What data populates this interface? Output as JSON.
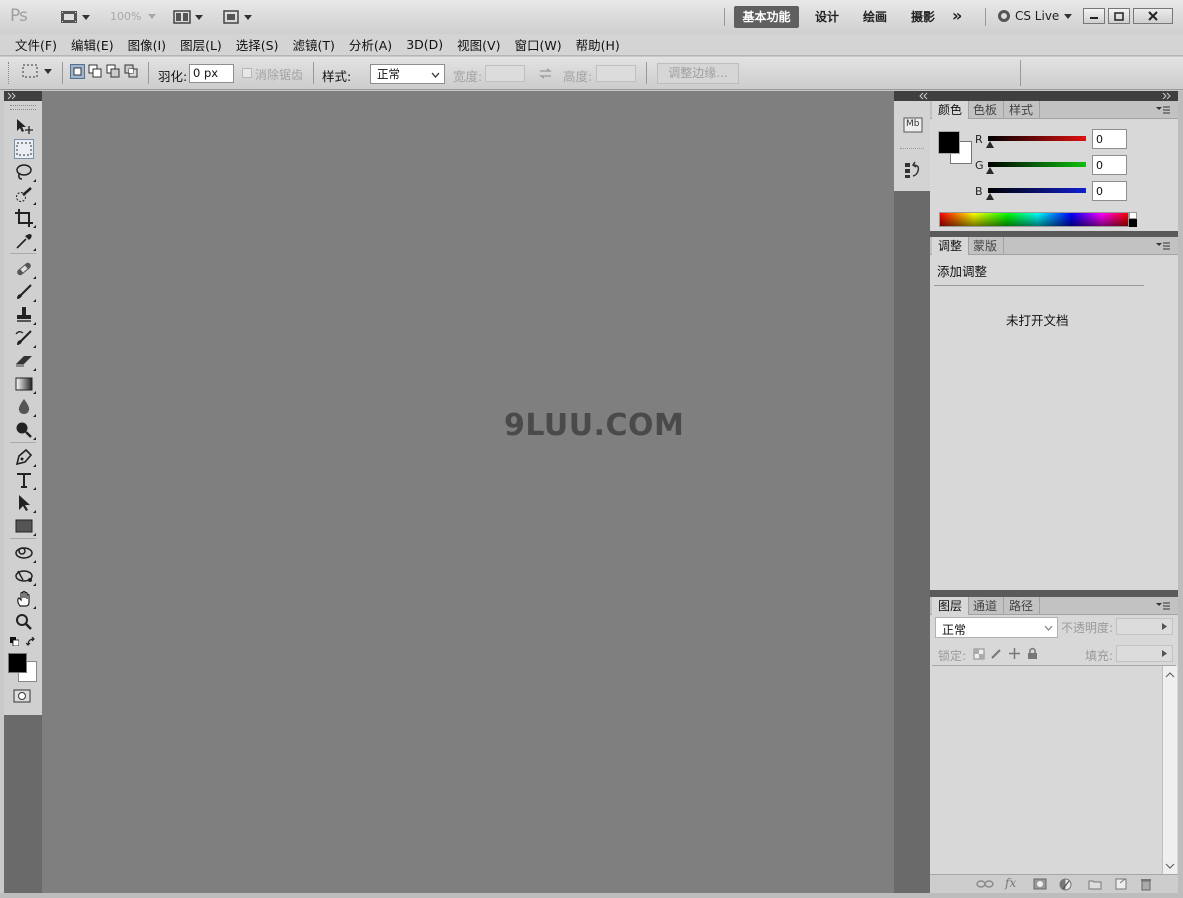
{
  "appbar": {
    "logo": "Ps",
    "zoom": "100%",
    "workspaces": [
      "基本功能",
      "设计",
      "绘画",
      "摄影"
    ],
    "more": "»",
    "cslive": "CS Live"
  },
  "menu": [
    "文件(F)",
    "编辑(E)",
    "图像(I)",
    "图层(L)",
    "选择(S)",
    "滤镜(T)",
    "分析(A)",
    "3D(D)",
    "视图(V)",
    "窗口(W)",
    "帮助(H)"
  ],
  "options": {
    "feather_label": "羽化:",
    "feather_value": "0 px",
    "antialias_label": "消除锯齿",
    "style_label": "样式:",
    "style_value": "正常",
    "width_label": "宽度:",
    "height_label": "高度:",
    "refine_edge": "调整边缘..."
  },
  "canvas": {
    "watermark": "9LUU.COM"
  },
  "color_panel": {
    "tabs": [
      "颜色",
      "色板",
      "样式"
    ],
    "channels": [
      {
        "label": "R",
        "value": "0",
        "color": "#e01010"
      },
      {
        "label": "G",
        "value": "0",
        "color": "#10c010"
      },
      {
        "label": "B",
        "value": "0",
        "color": "#1020d0"
      }
    ]
  },
  "adjust_panel": {
    "tabs": [
      "调整",
      "蒙版"
    ],
    "title": "添加调整",
    "empty_msg": "未打开文档"
  },
  "layers_panel": {
    "tabs": [
      "图层",
      "通道",
      "路径"
    ],
    "blend_mode": "正常",
    "opacity_label": "不透明度:",
    "lock_label": "锁定:",
    "fill_label": "填充:"
  },
  "dock": {
    "mini_bridge": "Mb"
  },
  "colors": {
    "accent_workspace": "#5f5f5f",
    "canvas_bg": "#7f7f7f",
    "panel_bg": "#d8d8d8"
  }
}
